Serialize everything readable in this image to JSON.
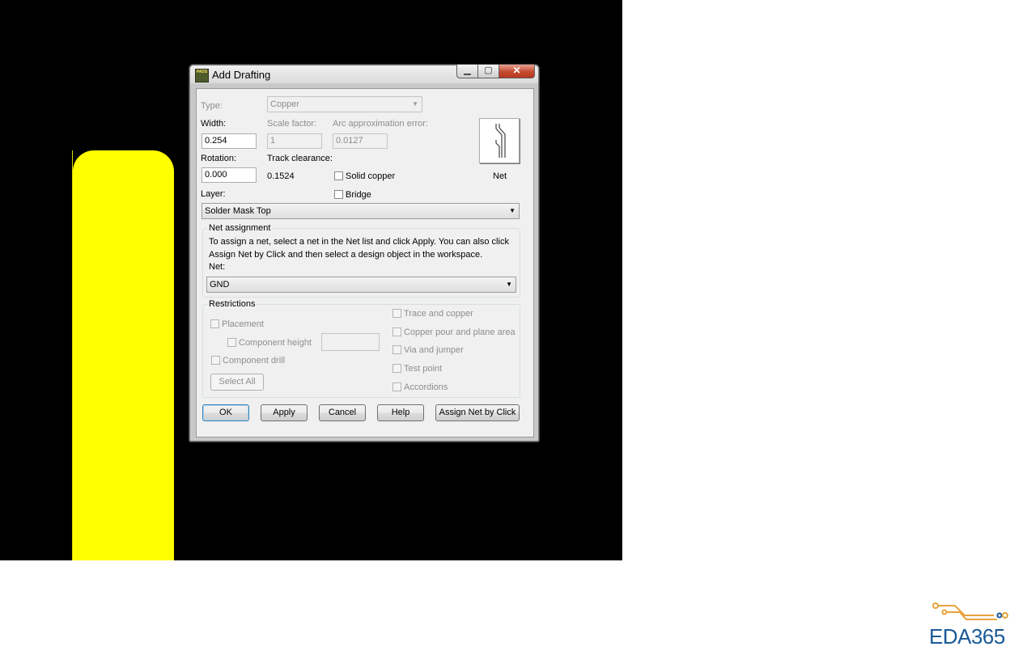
{
  "dialog": {
    "title": "Add Drafting",
    "app_icon_text": "PADS",
    "window_buttons": {
      "minimize": "▁",
      "maximize": "▢",
      "close": "✕"
    }
  },
  "type": {
    "label": "Type:",
    "value": "Copper"
  },
  "width": {
    "label": "Width:",
    "value": "0.254"
  },
  "scale_factor": {
    "label": "Scale factor:",
    "value": "1"
  },
  "arc_error": {
    "label": "Arc approximation error:",
    "value": "0.0127"
  },
  "rotation": {
    "label": "Rotation:",
    "value": "0.000"
  },
  "track_clearance": {
    "label": "Track clearance:",
    "value": "0.1524"
  },
  "solid_copper": {
    "label": "Solid copper",
    "checked": false
  },
  "bridge": {
    "label": "Bridge",
    "checked": false
  },
  "preview": {
    "label": "Net",
    "icon": "net-trace-icon"
  },
  "layer": {
    "label": "Layer:",
    "value": "Solder Mask Top"
  },
  "net_assignment": {
    "title": "Net assignment",
    "instructions_line1": "To assign a net, select a net in the Net list and click Apply. You can also click",
    "instructions_line2": "Assign Net by Click and then select a design object in the workspace.",
    "net_label": "Net:",
    "net_value": "GND"
  },
  "restrictions": {
    "title": "Restrictions",
    "placement": "Placement",
    "component_height": "Component height",
    "component_drill": "Component drill",
    "select_all": "Select All",
    "trace_and_copper": "Trace and copper",
    "copper_pour": "Copper pour and plane area",
    "via_and_jumper": "Via and jumper",
    "test_point": "Test point",
    "accordions": "Accordions"
  },
  "buttons": {
    "ok": "OK",
    "apply": "Apply",
    "cancel": "Cancel",
    "help": "Help",
    "assign_net": "Assign Net by Click"
  },
  "logo": {
    "text": "EDA365",
    "color": "#1a5a98",
    "accent": "#e8a33a"
  },
  "colors": {
    "canvas": "#000000",
    "copper": "#ffff00"
  }
}
